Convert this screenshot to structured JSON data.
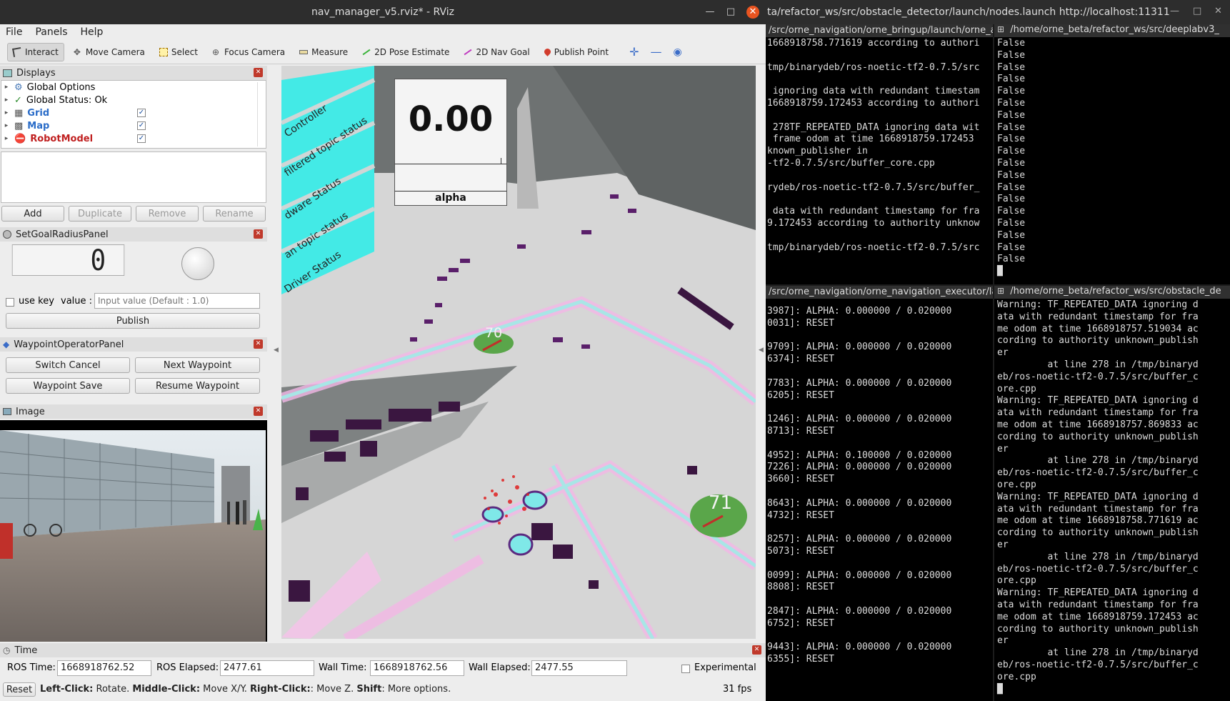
{
  "rviz": {
    "title": "nav_manager_v5.rviz* - RViz",
    "menu": [
      "File",
      "Panels",
      "Help"
    ],
    "toolbar": [
      "Interact",
      "Move Camera",
      "Select",
      "Focus Camera",
      "Measure",
      "2D Pose Estimate",
      "2D Nav Goal",
      "Publish Point"
    ],
    "displays": {
      "title": "Displays",
      "items": [
        {
          "label": "Global Options",
          "checked": null
        },
        {
          "label": "Global Status: Ok",
          "checked": null
        },
        {
          "label": "Grid",
          "checked": true
        },
        {
          "label": "Map",
          "checked": true
        },
        {
          "label": "RobotModel",
          "checked": true
        }
      ],
      "buttons": [
        "Add",
        "Duplicate",
        "Remove",
        "Rename"
      ]
    },
    "goal_panel": {
      "title": "SetGoalRadiusPanel",
      "lcd_value": "0",
      "use_key_label": "use key",
      "value_label": "value :",
      "value_placeholder": "Input value (Default : 1.0)",
      "publish_label": "Publish"
    },
    "waypoint_panel": {
      "title": "WaypointOperatorPanel",
      "buttons": [
        "Switch Cancel",
        "Next Waypoint",
        "Waypoint Save",
        "Resume Waypoint"
      ]
    },
    "image_panel": {
      "title": "Image"
    },
    "viewport": {
      "alpha_value": "0.00",
      "alpha_label": "alpha",
      "status_labels": [
        "Controller",
        "filtered topic status",
        "dware Status",
        "an topic status",
        "Driver Status"
      ],
      "waypoint_ids": [
        "70",
        "71"
      ]
    },
    "time": {
      "title": "Time",
      "ros_time_label": "ROS Time:",
      "ros_time": "1668918762.52",
      "ros_elapsed_label": "ROS Elapsed:",
      "ros_elapsed": "2477.61",
      "wall_time_label": "Wall Time:",
      "wall_time": "1668918762.56",
      "wall_elapsed_label": "Wall Elapsed:",
      "wall_elapsed": "2477.55",
      "experimental_label": "Experimental",
      "reset_label": "Reset",
      "hint_1_b": "Left-Click:",
      "hint_1": " Rotate.",
      "hint_2_b": "Middle-Click:",
      "hint_2": " Move X/Y.",
      "hint_3_b": "Right-Click:",
      "hint_3": ": Move Z.",
      "hint_4_b": "Shift",
      "hint_4": ": More options.",
      "fps": "31 fps"
    }
  },
  "terminal_window_title": "ta/refactor_ws/src/obstacle_detector/launch/nodes.launch http://localhost:11311",
  "terminals": {
    "tl_title": "/src/orne_navigation/orne_bringup/launch/orne_alp",
    "tl_text": "1668918758.771619 according to authori\n\ntmp/binarydeb/ros-noetic-tf2-0.7.5/src\n\n ignoring data with redundant timestam\n1668918759.172453 according to authori\n\n 278TF_REPEATED_DATA ignoring data wit\n frame odom at time 1668918759.172453\nknown_publisher in\n-tf2-0.7.5/src/buffer_core.cpp\n\nrydeb/ros-noetic-tf2-0.7.5/src/buffer_\n\n data with redundant timestamp for fra\n9.172453 according to authority unknow\n\ntmp/binarydeb/ros-noetic-tf2-0.7.5/src",
    "tr_title": "/home/orne_beta/refactor_ws/src/deeplabv3_",
    "tr_text": "False\nFalse\nFalse\nFalse\nFalse\nFalse\nFalse\nFalse\nFalse\nFalse\nFalse\nFalse\nFalse\nFalse\nFalse\nFalse\nFalse\nFalse\nFalse\n█",
    "bl_title": "/src/orne_navigation/orne_navigation_executor/laun",
    "bl_text": "3987]: ALPHA: 0.000000 / 0.020000\n0031]: RESET\n\n9709]: ALPHA: 0.000000 / 0.020000\n6374]: RESET\n\n7783]: ALPHA: 0.000000 / 0.020000\n6205]: RESET\n\n1246]: ALPHA: 0.000000 / 0.020000\n8713]: RESET\n\n4952]: ALPHA: 0.100000 / 0.020000\n7226]: ALPHA: 0.000000 / 0.020000\n3660]: RESET\n\n8643]: ALPHA: 0.000000 / 0.020000\n4732]: RESET\n\n8257]: ALPHA: 0.000000 / 0.020000\n5073]: RESET\n\n0099]: ALPHA: 0.000000 / 0.020000\n8808]: RESET\n\n2847]: ALPHA: 0.000000 / 0.020000\n6752]: RESET\n\n9443]: ALPHA: 0.000000 / 0.020000\n6355]: RESET",
    "br_title": "/home/orne_beta/refactor_ws/src/obstacle_de",
    "br_text": "Warning: TF_REPEATED_DATA ignoring d\nata with redundant timestamp for fra\nme odom at time 1668918757.519034 ac\ncording to authority unknown_publish\ner\n         at line 278 in /tmp/binaryd\neb/ros-noetic-tf2-0.7.5/src/buffer_c\nore.cpp\nWarning: TF_REPEATED_DATA ignoring d\nata with redundant timestamp for fra\nme odom at time 1668918757.869833 ac\ncording to authority unknown_publish\ner\n         at line 278 in /tmp/binaryd\neb/ros-noetic-tf2-0.7.5/src/buffer_c\nore.cpp\nWarning: TF_REPEATED_DATA ignoring d\nata with redundant timestamp for fra\nme odom at time 1668918758.771619 ac\ncording to authority unknown_publish\ner\n         at line 278 in /tmp/binaryd\neb/ros-noetic-tf2-0.7.5/src/buffer_c\nore.cpp\nWarning: TF_REPEATED_DATA ignoring d\nata with redundant timestamp for fra\nme odom at time 1668918759.172453 ac\ncording to authority unknown_publish\ner\n         at line 278 in /tmp/binaryd\neb/ros-noetic-tf2-0.7.5/src/buffer_c\nore.cpp\n█"
  }
}
